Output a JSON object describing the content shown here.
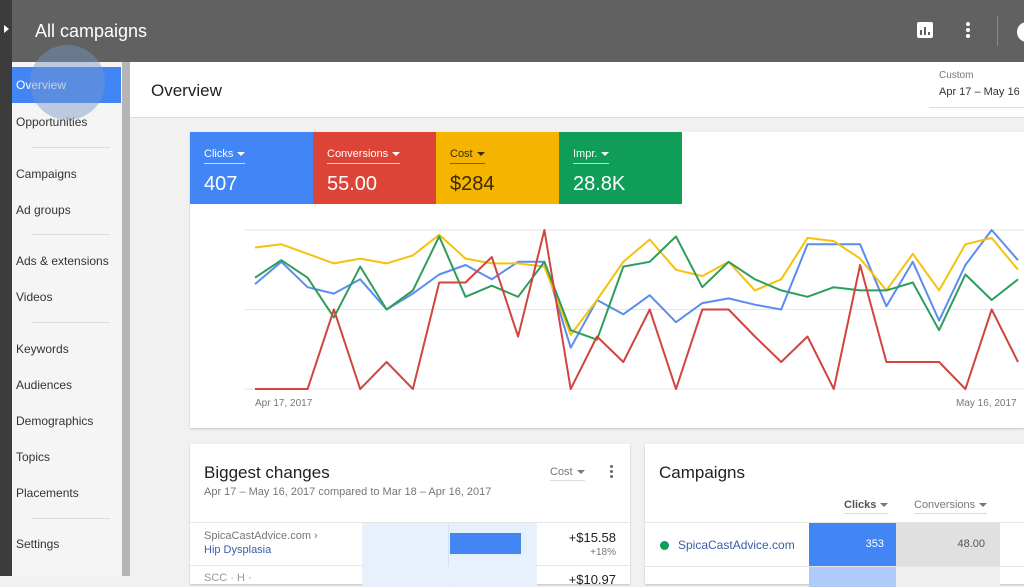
{
  "topbar": {
    "title": "All campaigns",
    "icons": [
      "reports-icon",
      "more-vert-icon",
      "account-avatar"
    ]
  },
  "sidebar": {
    "items": [
      {
        "label": "Overview",
        "active": true
      },
      {
        "label": "Opportunities"
      },
      {
        "label": "Campaigns"
      },
      {
        "label": "Ad groups"
      },
      {
        "label": "Ads & extensions"
      },
      {
        "label": "Videos"
      },
      {
        "label": "Keywords"
      },
      {
        "label": "Audiences"
      },
      {
        "label": "Demographics"
      },
      {
        "label": "Topics"
      },
      {
        "label": "Placements"
      },
      {
        "label": "Settings"
      }
    ]
  },
  "header": {
    "page_title": "Overview",
    "date_range_label": "Custom",
    "date_range_value": "Apr 17 – May 16"
  },
  "metrics": [
    {
      "label": "Clicks",
      "value": "407",
      "color": "#4285f4"
    },
    {
      "label": "Conversions",
      "value": "55.00",
      "color": "#db4437"
    },
    {
      "label": "Cost",
      "value": "$284",
      "color": "#f4b400"
    },
    {
      "label": "Impr.",
      "value": "28.8K",
      "color": "#0f9d58"
    }
  ],
  "chart_data": {
    "type": "line",
    "title": "",
    "xlabel": "",
    "ylabel": "",
    "x_tick_labels": [
      "Apr 17, 2017",
      "May 16, 2017"
    ],
    "x": [
      "Apr 17",
      "Apr 18",
      "Apr 19",
      "Apr 20",
      "Apr 21",
      "Apr 22",
      "Apr 23",
      "Apr 24",
      "Apr 25",
      "Apr 26",
      "Apr 27",
      "Apr 28",
      "Apr 29",
      "Apr 30",
      "May 1",
      "May 2",
      "May 3",
      "May 4",
      "May 5",
      "May 6",
      "May 7",
      "May 8",
      "May 9",
      "May 10",
      "May 11",
      "May 12",
      "May 13",
      "May 14",
      "May 15",
      "May 16"
    ],
    "ylim": [
      0,
      100
    ],
    "y_scale_note": "normalized per series (no y-axis labels shown)",
    "grid": true,
    "legend": "none",
    "series": [
      {
        "name": "Clicks",
        "color": "#5b8def",
        "values": [
          66,
          80,
          64,
          60,
          69,
          50,
          60,
          72,
          78,
          69,
          80,
          80,
          26,
          56,
          47,
          59,
          42,
          54,
          57,
          53,
          50,
          91,
          91,
          91,
          52,
          80,
          43,
          78,
          100,
          81
        ]
      },
      {
        "name": "Cost",
        "color": "#f4c20d",
        "values": [
          89,
          91,
          85,
          79,
          82,
          79,
          84,
          97,
          82,
          79,
          79,
          77,
          34,
          56,
          80,
          94,
          75,
          71,
          80,
          62,
          69,
          95,
          93,
          82,
          62,
          85,
          62,
          91,
          95,
          75
        ]
      },
      {
        "name": "Impr.",
        "color": "#2e9d5b",
        "values": [
          70,
          81,
          70,
          45,
          77,
          50,
          62,
          96,
          58,
          65,
          58,
          80,
          37,
          31,
          77,
          80,
          96,
          64,
          80,
          69,
          62,
          58,
          64,
          62,
          62,
          67,
          37,
          72,
          56,
          69
        ]
      },
      {
        "name": "Conversions",
        "color": "#d0453f",
        "values": [
          0,
          0,
          0,
          50,
          0,
          17,
          0,
          67,
          67,
          83,
          33,
          100,
          0,
          33,
          17,
          50,
          0,
          50,
          50,
          33,
          17,
          33,
          0,
          78,
          17,
          17,
          17,
          0,
          50,
          17
        ]
      }
    ]
  },
  "biggest_changes": {
    "title": "Biggest changes",
    "subtitle": "Apr 17 – May 16, 2017 compared to Mar 18 – Apr 16, 2017",
    "metric_select": "Cost",
    "rows": [
      {
        "path": "SpicaCastAdvice.com ›",
        "name": "Hip Dysplasia",
        "amount": "+$15.58",
        "percent": "+18%"
      },
      {
        "path": "SCC · H ·",
        "name": "",
        "amount": "+$10.97",
        "percent": ""
      }
    ]
  },
  "campaigns": {
    "title": "Campaigns",
    "columns": [
      "Clicks",
      "Conversions"
    ],
    "rows": [
      {
        "name": "SpicaCastAdvice.com",
        "status_color": "#0f9d58",
        "clicks": "353",
        "conversions": "48.00"
      }
    ]
  }
}
